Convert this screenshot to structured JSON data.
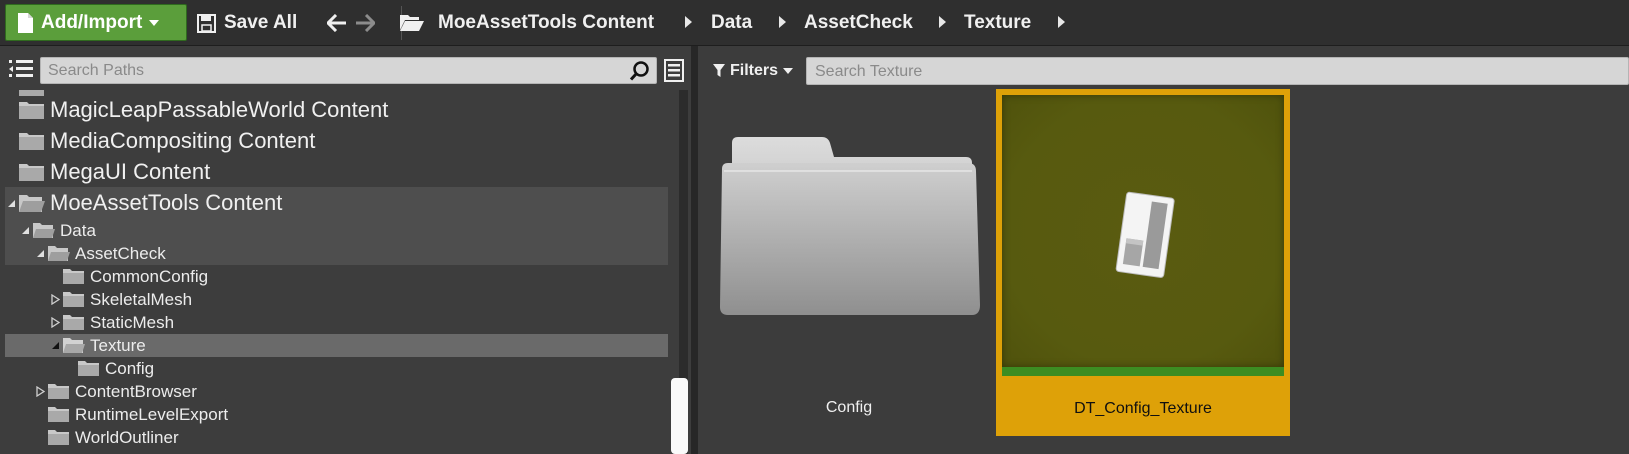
{
  "toolbar": {
    "add_import_label": "Add/Import",
    "save_all_label": "Save All",
    "breadcrumbs": [
      "MoeAssetTools Content",
      "Data",
      "AssetCheck",
      "Texture"
    ]
  },
  "sources_panel": {
    "search_placeholder": "Search Paths",
    "tree": [
      {
        "label": "MagicLeapPassableWorld Content"
      },
      {
        "label": "MediaCompositing Content"
      },
      {
        "label": "MegaUI Content"
      },
      {
        "label": "MoeAssetTools Content"
      },
      {
        "label": "Data"
      },
      {
        "label": "AssetCheck"
      },
      {
        "label": "CommonConfig"
      },
      {
        "label": "SkeletalMesh"
      },
      {
        "label": "StaticMesh"
      },
      {
        "label": "Texture"
      },
      {
        "label": "Config"
      },
      {
        "label": "ContentBrowser"
      },
      {
        "label": "RuntimeLevelExport"
      },
      {
        "label": "WorldOutliner"
      }
    ]
  },
  "asset_view": {
    "filters_label": "Filters",
    "search_placeholder": "Search Texture",
    "items": [
      {
        "label": "Config",
        "type": "folder"
      },
      {
        "label": "DT_Config_Texture",
        "type": "data-table",
        "selected": true
      }
    ]
  },
  "colors": {
    "add_button": "#5b9e3b",
    "selection": "#dea108",
    "asset_thumb": "#575a0f",
    "asset_type_bar": "#3c8d22"
  }
}
